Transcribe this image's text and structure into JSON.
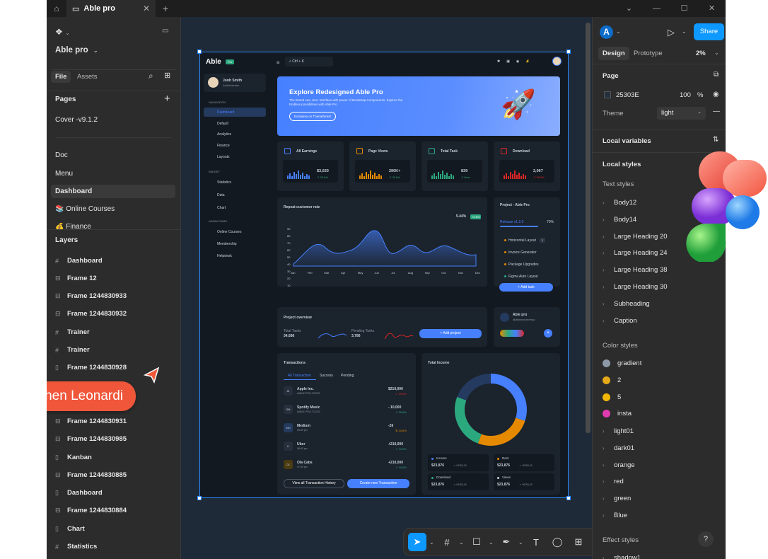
{
  "tabs": {
    "active_title": "Able pro"
  },
  "left": {
    "project_name": "Able pro",
    "file_tab": "File",
    "assets_tab": "Assets",
    "pages_heading": "Pages",
    "pages": [
      "Cover -v9.1.2",
      "Doc",
      "Menu",
      "Dashboard",
      "Online Courses",
      "Finance"
    ],
    "layers_heading": "Layers",
    "layers": [
      "Dashboard",
      "Frame 12",
      "Frame 1244830933",
      "Frame 1244830932",
      "Trainer",
      "Trainer",
      "Frame 1244830928",
      "Frame 1244830931",
      "Frame 1244830985",
      "Kanban",
      "Frame 1244830885",
      "Dashboard",
      "Frame 1244830884",
      "Chart",
      "Statistics"
    ]
  },
  "cursor": {
    "name": "Stephen Leonardi"
  },
  "right": {
    "avatar": "A",
    "share": "Share",
    "design_tab": "Design",
    "prototype_tab": "Prototype",
    "zoom": "2%",
    "page_heading": "Page",
    "page_color": "25303E",
    "page_opacity": "100",
    "page_opacity_unit": "%",
    "theme_label": "Theme",
    "theme_value": "light",
    "local_variables": "Local variables",
    "local_styles": "Local styles",
    "text_styles_heading": "Text styles",
    "text_styles": [
      "Body12",
      "Body14",
      "Large Heading 20",
      "Large Heading 24",
      "Large Heading 38",
      "Large Heading 30",
      "Subheading",
      "Caption"
    ],
    "color_styles_heading": "Color styles",
    "color_styles": [
      {
        "name": "gradient",
        "color": "#8e99a8"
      },
      {
        "name": "2",
        "color": "#e5a91a"
      },
      {
        "name": "5",
        "color": "#f2b705"
      },
      {
        "name": "insta",
        "color": "#e13bb0"
      }
    ],
    "color_groups": [
      "light01",
      "dark01",
      "orange",
      "red",
      "green",
      "Blue"
    ],
    "effect_styles_heading": "Effect styles",
    "effect_first": "shadow1"
  },
  "toolbar": {
    "code_label": "</>"
  },
  "design": {
    "logo": "Able",
    "logo_badge": "Pro",
    "search": "Ctrl + K",
    "user_name": "Jonh Smith",
    "user_role": "Administrator",
    "nav_heading": "NAVIGATION",
    "nav_items": [
      "Dashboard",
      "Default",
      "Analytics",
      "Finance",
      "Layouts"
    ],
    "widget_heading": "WIDGET",
    "widget_items": [
      "Statistics",
      "Data",
      "Chart"
    ],
    "admin_heading": "ADMIN PANEL",
    "admin_items": [
      "Online Courses",
      "Membership",
      "Helpdesk"
    ],
    "banner_title": "Explore Redesigned Able Pro",
    "banner_text": "The Brand new User Interface with power of Bootstrap Components. Explore the Endless possibilities with Able Pro.",
    "banner_button": "Exclusive on Themeforest",
    "stats": [
      {
        "title": "All Earnings",
        "value": "$3,020",
        "delta": "↗ 30.6%",
        "color": "#4680ff"
      },
      {
        "title": "Page Views",
        "value": "290K+",
        "delta": "↗ 30.6%",
        "color": "#e58a00"
      },
      {
        "title": "Total Task",
        "value": "839",
        "delta": "↗ New",
        "color": "#2ca87f"
      },
      {
        "title": "Download",
        "value": "2,067",
        "delta": "↗ 30.6%",
        "color": "#dc2626"
      }
    ],
    "repeat_title": "Repeat customer rate",
    "repeat_value": "5.44%",
    "repeat_badge": "+2.6%",
    "months": [
      "Jan",
      "Feb",
      "Mar",
      "Apr",
      "May",
      "Jun",
      "Jul",
      "Aug",
      "Sep",
      "Oct",
      "Nov",
      "Dec"
    ],
    "yticks": [
      "90",
      "80",
      "70",
      "60",
      "50",
      "40",
      "30",
      "20",
      "10"
    ],
    "project_title": "Project - Able Pro",
    "release_label": "Release v1.2.0",
    "release_pct": "70%",
    "project_items": [
      "Horizontal Layout",
      "Invoice Generator",
      "Package Upgrades",
      "Figma Auto Layout"
    ],
    "project_badge": "2",
    "add_task": "+ Add task",
    "overview_title": "Project overview",
    "total_tasks_label": "Total Tasks",
    "total_tasks": "34,686",
    "pending_label": "Pending Tasks",
    "pending": "3,786",
    "add_project": "+ Add project",
    "able_card_title": "Able pro",
    "able_card_sub": "@ableprodevelop",
    "tx_title": "Transactions",
    "tx_tabs": [
      "All Transaction",
      "Success",
      "Pending"
    ],
    "tx": [
      {
        "ab": "AI",
        "name": "Apple Inc.",
        "id": "#ABLE-PRO-T00232",
        "amt": "$210,000",
        "d": "↙ 10.6%",
        "up": false
      },
      {
        "ab": "SM",
        "name": "Spotify Music",
        "id": "#ABLE-PRO-T10232",
        "amt": "- 10,000",
        "d": "↗ 30.6%",
        "up": true
      },
      {
        "ab": "MD",
        "name": "Medium",
        "id": "06:30 pm",
        "amt": "-26",
        "d": "⇅ 10.6%",
        "up": null
      },
      {
        "ab": "U",
        "name": "Uber",
        "id": "08:40 pm",
        "amt": "+210,000",
        "d": "↗ 10.6%",
        "up": true
      },
      {
        "ab": "OC",
        "name": "Ola Cabs",
        "id": "07:40 pm",
        "amt": "+210,000",
        "d": "↗ 10.6%",
        "up": true
      }
    ],
    "tx_btn1": "View all Transaction History",
    "tx_btn2": "Create new Transaction",
    "income_title": "Total Income",
    "income_tiles": [
      {
        "label": "Income",
        "value": "$23,876",
        "delta": "↗ +$763,43",
        "color": "#4680ff"
      },
      {
        "label": "Rent",
        "value": "$23,876",
        "delta": "↗ +$763,43",
        "color": "#e58a00"
      },
      {
        "label": "Download",
        "value": "$23,876",
        "delta": "↗ +$763,43",
        "color": "#2ca87f"
      },
      {
        "label": "Views",
        "value": "$23,876",
        "delta": "↗ +$763,43",
        "color": "#c9d1dc"
      }
    ]
  }
}
